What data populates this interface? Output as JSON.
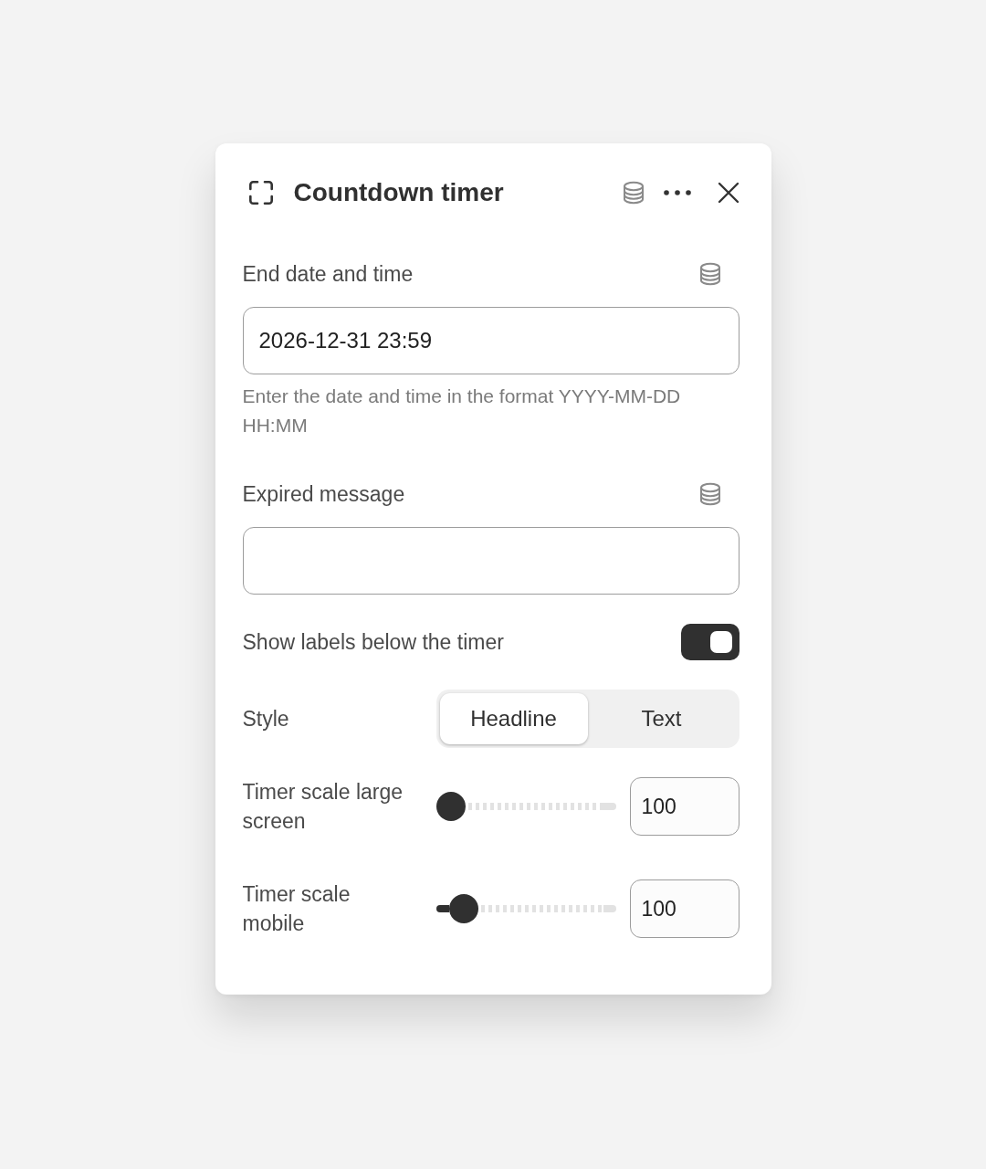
{
  "panel": {
    "title": "Countdown timer"
  },
  "fields": [
    {
      "kind": "text",
      "label": "End date and time",
      "value": "2026-12-31 23:59",
      "help": "Enter the date and time in the format YYYY-MM-DD HH:MM"
    },
    {
      "kind": "text",
      "label": "Expired message"
    },
    {
      "kind": "toggle",
      "label": "Show labels below the timer",
      "on": true
    },
    {
      "kind": "segmented",
      "label": "Style",
      "options": [
        {
          "label": "Headline",
          "selected": true
        },
        {
          "label": "Text",
          "selected": false
        }
      ]
    },
    {
      "kind": "slider",
      "label": "Timer scale large screen",
      "level": 0,
      "value": "100"
    },
    {
      "kind": "slider",
      "label": "Timer scale mobile",
      "level": 0.09,
      "value": "100"
    }
  ]
}
